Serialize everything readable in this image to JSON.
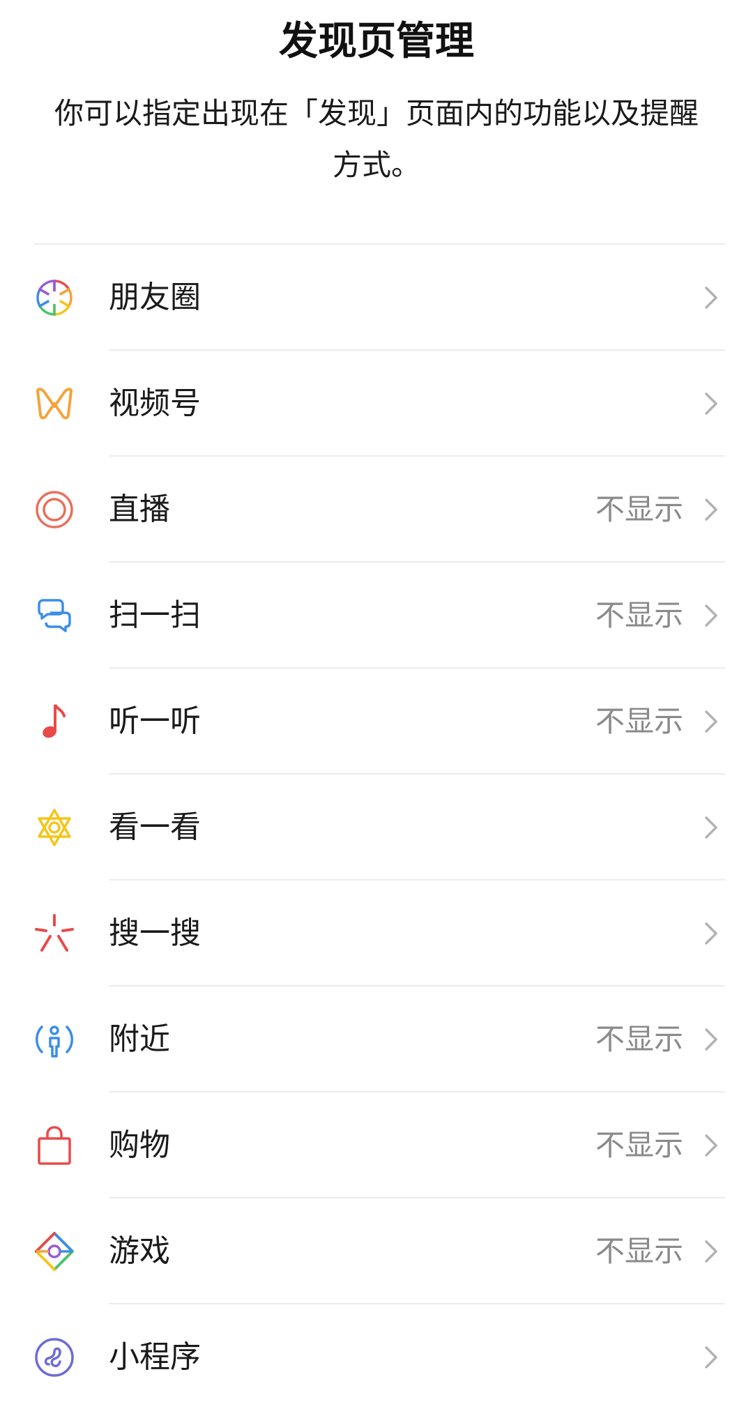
{
  "header": {
    "title": "发现页管理",
    "description": "你可以指定出现在「发现」页面内的功能以及提醒方式。"
  },
  "items": [
    {
      "label": "朋友圈",
      "status": "",
      "icon": "moments-aperture-icon"
    },
    {
      "label": "视频号",
      "status": "",
      "icon": "channels-icon"
    },
    {
      "label": "直播",
      "status": "不显示",
      "icon": "live-icon"
    },
    {
      "label": "扫一扫",
      "status": "不显示",
      "icon": "scan-icon"
    },
    {
      "label": "听一听",
      "status": "不显示",
      "icon": "music-note-icon"
    },
    {
      "label": "看一看",
      "status": "",
      "icon": "top-stories-icon"
    },
    {
      "label": "搜一搜",
      "status": "",
      "icon": "search-sparkle-icon"
    },
    {
      "label": "附近",
      "status": "不显示",
      "icon": "nearby-icon"
    },
    {
      "label": "购物",
      "status": "不显示",
      "icon": "shopping-bag-icon"
    },
    {
      "label": "游戏",
      "status": "不显示",
      "icon": "games-icon"
    },
    {
      "label": "小程序",
      "status": "",
      "icon": "mini-programs-icon"
    }
  ],
  "colors": {
    "channels": "#F5A33A",
    "live": "#E8705A",
    "scan": "#3A8EE6",
    "music": "#E84A4A",
    "stories": "#F5C518",
    "search": "#E84A4A",
    "nearby": "#3A8EE6",
    "shopping": "#E84A4A",
    "mini_programs": "#6B6BD6",
    "status_text": "#8A8A8A",
    "chevron": "#B2B2B2"
  }
}
